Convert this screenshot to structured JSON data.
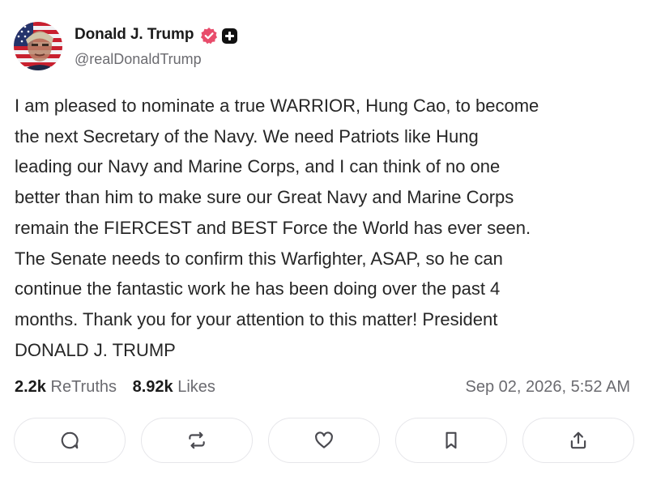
{
  "author": {
    "name": "Donald J. Trump",
    "handle": "@realDonaldTrump",
    "avatar_icon": "flag-portrait-avatar",
    "verified_icon": "verified-badge-icon",
    "verified_color": "#e84c6b",
    "plus_icon": "plus-square-icon"
  },
  "post": {
    "text": "I am pleased to nominate a true WARRIOR, Hung Cao, to become\nthe next Secretary of the Navy. We need Patriots like Hung\nleading our Navy and Marine Corps, and I can think of no one\nbetter than him to make sure our Great Navy and Marine Corps\nremain the FIERCEST and BEST Force the World has ever seen.\nThe Senate needs to confirm this Warfighter, ASAP, so he can\ncontinue the fantastic work he has been doing over the past 4\nmonths. Thank you for your attention to this matter! President\nDONALD J. TRUMP"
  },
  "stats": {
    "retruths_count": "2.2k",
    "retruths_label": "ReTruths",
    "likes_count": "8.92k",
    "likes_label": "Likes",
    "timestamp": "Sep 02, 2026, 5:52 AM"
  },
  "actions": [
    {
      "icon": "reply-icon"
    },
    {
      "icon": "retruth-icon"
    },
    {
      "icon": "heart-icon"
    },
    {
      "icon": "bookmark-icon"
    },
    {
      "icon": "share-icon"
    }
  ]
}
